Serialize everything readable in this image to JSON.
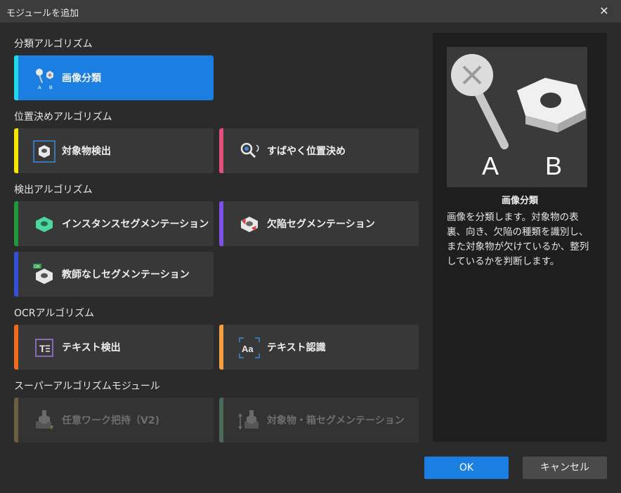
{
  "dialog": {
    "title": "モジュールを追加",
    "close_symbol": "✕"
  },
  "sections": {
    "classification": "分類アルゴリズム",
    "positioning": "位置決めアルゴリズム",
    "detection": "検出アルゴリズム",
    "ocr": "OCRアルゴリズム",
    "super": "スーパーアルゴリズムモジュール"
  },
  "modules": {
    "image_classification": {
      "label": "画像分類",
      "accent": "#20d8e8",
      "icon": "pin-nut-icon",
      "sub_a": "A",
      "sub_b": "B"
    },
    "object_detection": {
      "label": "対象物検出",
      "accent": "#f5e600",
      "icon": "nut-box-icon"
    },
    "fast_positioning": {
      "label": "すばやく位置決め",
      "accent": "#e0507a",
      "icon": "magnifier-icon"
    },
    "instance_segmentation": {
      "label": "インスタンスセグメンテーション",
      "accent": "#1f9a3a",
      "icon": "green-nut-icon"
    },
    "defect_segmentation": {
      "label": "欠陥セグメンテーション",
      "accent": "#7b52e8",
      "icon": "defect-nut-icon"
    },
    "unsupervised_segmentation": {
      "label": "教師なしセグメンテーション",
      "accent": "#3550d8",
      "icon": "ok-nut-icon",
      "badge": "OK"
    },
    "text_detection": {
      "label": "テキスト検出",
      "accent": "#f06a1e",
      "icon": "text-detect-icon",
      "glyph": "T"
    },
    "text_recognition": {
      "label": "テキスト認識",
      "accent": "#f5a040",
      "icon": "text-recognize-icon",
      "glyph": "Aa"
    },
    "any_workpiece_picking": {
      "label": "任意ワーク把持（V2)",
      "accent": "#6a6040",
      "icon": "workpiece-picking-icon"
    },
    "object_box_segmentation": {
      "label": "対象物・箱セグメンテーション",
      "accent": "#4a6a5a",
      "icon": "box-segmentation-icon"
    }
  },
  "preview": {
    "title": "画像分類",
    "label_a": "A",
    "label_b": "B",
    "description": "画像を分類します。対象物の表裏、向き、欠陥の種類を識別し、また対象物が欠けているか、整列しているかを判断します。"
  },
  "buttons": {
    "ok": "OK",
    "cancel": "キャンセル"
  }
}
